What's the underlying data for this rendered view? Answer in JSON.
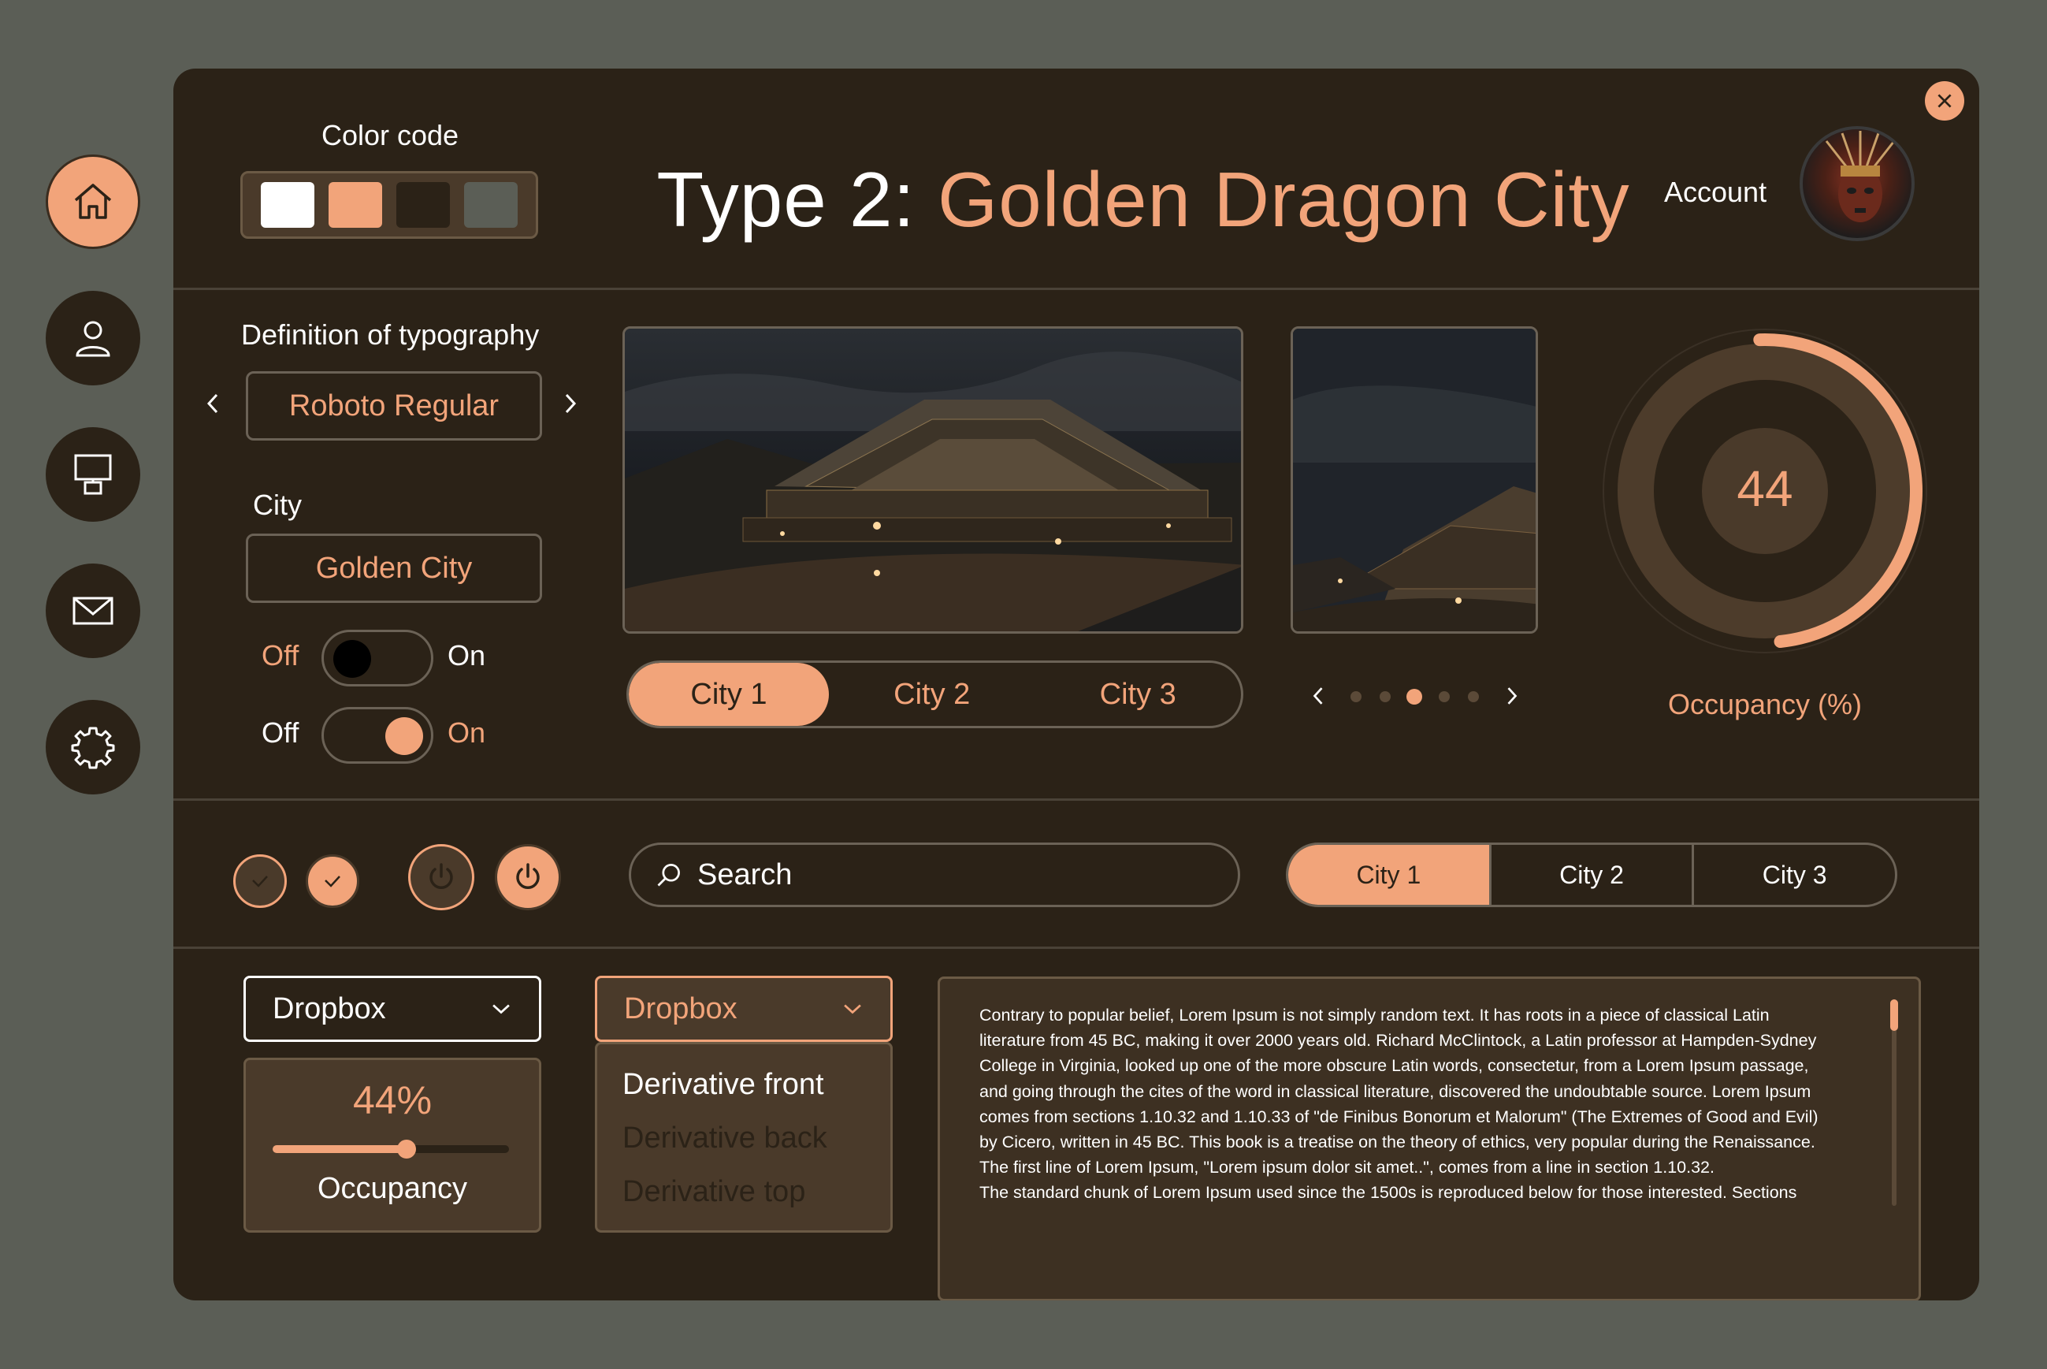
{
  "colors": {
    "background": "#5b5e56",
    "panel": "#2b2217",
    "accent": "#f2a47a",
    "swatches": [
      "#ffffff",
      "#f2a47a",
      "#2b2217",
      "#5b5e56"
    ]
  },
  "nav": {
    "items": [
      {
        "icon": "home-icon",
        "active": true
      },
      {
        "icon": "user-icon",
        "active": false
      },
      {
        "icon": "monitor-icon",
        "active": false
      },
      {
        "icon": "mail-icon",
        "active": false
      },
      {
        "icon": "gear-icon",
        "active": false
      }
    ]
  },
  "header": {
    "color_code_label": "Color code",
    "title_prefix": "Type 2:",
    "title_main": "Golden Dragon City",
    "account_label": "Account"
  },
  "typography": {
    "label": "Definition of typography",
    "value": "Roboto Regular"
  },
  "city": {
    "label": "City",
    "value": "Golden City"
  },
  "toggles": [
    {
      "off_label": "Off",
      "on_label": "On",
      "state": "off"
    },
    {
      "off_label": "Off",
      "on_label": "On",
      "state": "on"
    }
  ],
  "city_tabs": {
    "items": [
      "City 1",
      "City 2",
      "City 3"
    ],
    "active": 0
  },
  "carousel": {
    "dots": 5,
    "active": 2
  },
  "occupancy_gauge": {
    "value": "44",
    "label": "Occupancy (%)",
    "fraction": 0.44
  },
  "search": {
    "placeholder": "Search"
  },
  "city_segments": {
    "items": [
      "City 1",
      "City 2",
      "City 3"
    ],
    "active": 0
  },
  "dropbox1": {
    "label": "Dropbox"
  },
  "occupancy_card": {
    "value": "44%",
    "label": "Occupancy",
    "fraction": 0.57
  },
  "dropbox2": {
    "label": "Dropbox",
    "options": [
      "Derivative front",
      "Derivative back",
      "Derivative top"
    ],
    "selected": 0
  },
  "lorem": {
    "lines": [
      "Contrary to popular belief, Lorem Ipsum is not simply random text. It has roots in a piece of classical Latin",
      "literature from 45 BC, making it over 2000 years old. Richard McClintock, a Latin professor at Hampden-Sydney",
      "College in Virginia, looked up one of the more obscure Latin words, consectetur, from a Lorem Ipsum passage,",
      "and going through the cites of the word in classical literature, discovered the undoubtable source. Lorem Ipsum",
      "comes from sections 1.10.32 and 1.10.33 of \"de Finibus Bonorum et Malorum\" (The Extremes of Good and Evil)",
      "by Cicero, written in 45 BC. This book is a treatise on the theory of ethics, very popular during the Renaissance.",
      "The first line of Lorem Ipsum, \"Lorem ipsum dolor sit amet..\", comes from a line in section 1.10.32.",
      "The standard chunk of Lorem Ipsum used since the 1500s is reproduced below for those interested. Sections"
    ]
  }
}
